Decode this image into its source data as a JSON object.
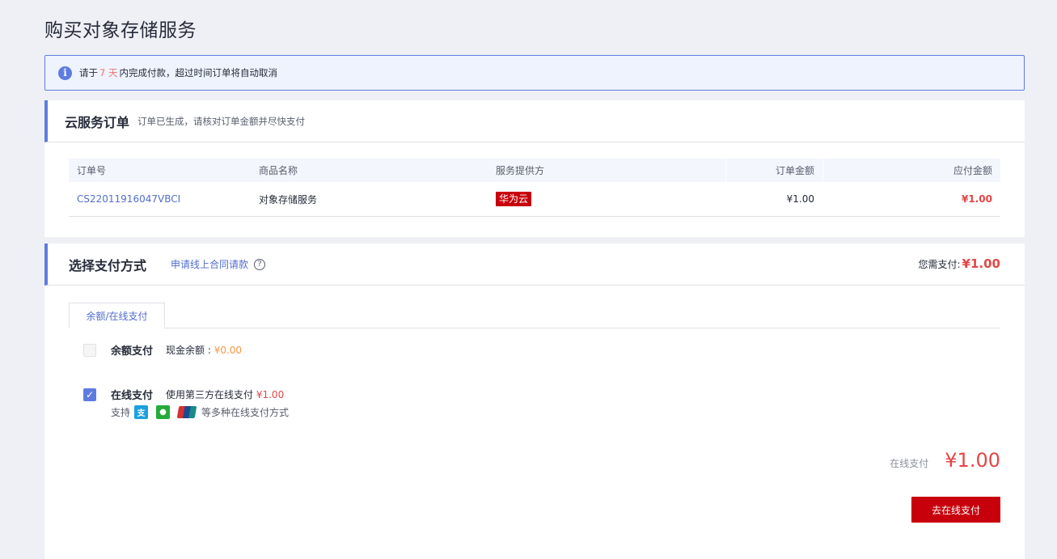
{
  "page": {
    "title": "购买对象存储服务"
  },
  "notice": {
    "prefix": "请于",
    "days": "7 天",
    "suffix": "内完成付款，超过时间订单将自动取消",
    "icon": "info-icon"
  },
  "order": {
    "title": "云服务订单",
    "subtitle": "订单已生成，请核对订单金额并尽快支付",
    "columns": [
      "订单号",
      "商品名称",
      "服务提供方",
      "订单金额",
      "应付金额"
    ],
    "row": {
      "order_id": "CS22011916047VBCI",
      "product": "对象存储服务",
      "vendor": "华为云",
      "amount": "¥1.00",
      "payable": "¥1.00"
    }
  },
  "payment": {
    "title": "选择支付方式",
    "apply_link": "申请线上合同请款",
    "need_pay_label": "您需支付:",
    "need_pay_value": "¥1.00",
    "tab": "余额/在线支付",
    "balance": {
      "label": "余额支付",
      "desc": "现金余额 : ",
      "value": "¥0.00",
      "checked": false
    },
    "online": {
      "label": "在线支付",
      "desc": "使用第三方在线支付 ",
      "value": "¥1.00",
      "checked": true
    },
    "support_prefix": "支持",
    "support_suffix": "等多种在线支付方式",
    "total_label": "在线支付",
    "total_value": "¥1.00",
    "pay_button": "去在线支付"
  },
  "colors": {
    "accent": "#5e7ce0",
    "brand_red": "#c7000b",
    "price_red": "#e54545",
    "balance_orange": "#fa9841"
  }
}
